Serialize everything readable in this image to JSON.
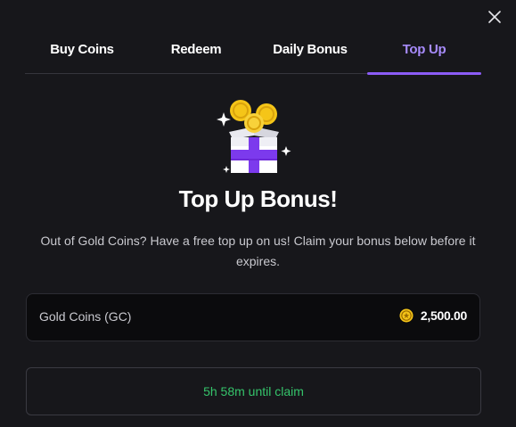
{
  "tabs": [
    {
      "label": "Buy Coins",
      "active": false
    },
    {
      "label": "Redeem",
      "active": false
    },
    {
      "label": "Daily Bonus",
      "active": false
    },
    {
      "label": "Top Up",
      "active": true
    }
  ],
  "content": {
    "title": "Top Up Bonus!",
    "description": "Out of Gold Coins? Have a free top up on us! Claim your bonus below before it expires.",
    "hero_icon": "gift-box-with-coins-icon"
  },
  "balance": {
    "label": "Gold Coins (GC)",
    "value": "2,500.00",
    "icon": "gold-coin-icon"
  },
  "claim_button": {
    "label": "5h 58m until claim"
  },
  "colors": {
    "background": "#17171b",
    "accent": "#8b5cf6",
    "accent_text": "#a78bfa",
    "timer_green": "#35c46b",
    "coin_gold": "#f5c518"
  }
}
